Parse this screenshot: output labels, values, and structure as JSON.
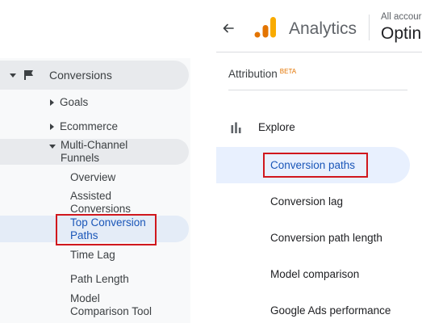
{
  "left_nav": {
    "conversions_label": "Conversions",
    "items": [
      {
        "label": "Goals"
      },
      {
        "label": "Ecommerce"
      },
      {
        "label_line1": "Multi-Channel",
        "label_line2": "Funnels"
      }
    ],
    "mcf_subitems": {
      "overview": "Overview",
      "assisted_line1": "Assisted",
      "assisted_line2": "Conversions",
      "top_line1": "Top Conversion",
      "top_line2": "Paths",
      "time_lag": "Time Lag",
      "path_length": "Path Length",
      "model_line1": "Model",
      "model_line2": "Comparison Tool"
    }
  },
  "ga4": {
    "app_name": "Analytics",
    "account_label": "All accour",
    "property_label": "Optin",
    "section_title": "Attribution",
    "section_badge": "BETA",
    "explore_label": "Explore",
    "items": {
      "conversion_paths": "Conversion paths",
      "conversion_lag": "Conversion lag",
      "conversion_path_length": "Conversion path length",
      "model_comparison": "Model comparison",
      "google_ads_performance": "Google Ads performance"
    }
  },
  "colors": {
    "highlight_red": "#d0171d",
    "active_blue": "#1a56b8",
    "ga_orange": "#f9ab00",
    "ga_orange_dark": "#e37400"
  }
}
